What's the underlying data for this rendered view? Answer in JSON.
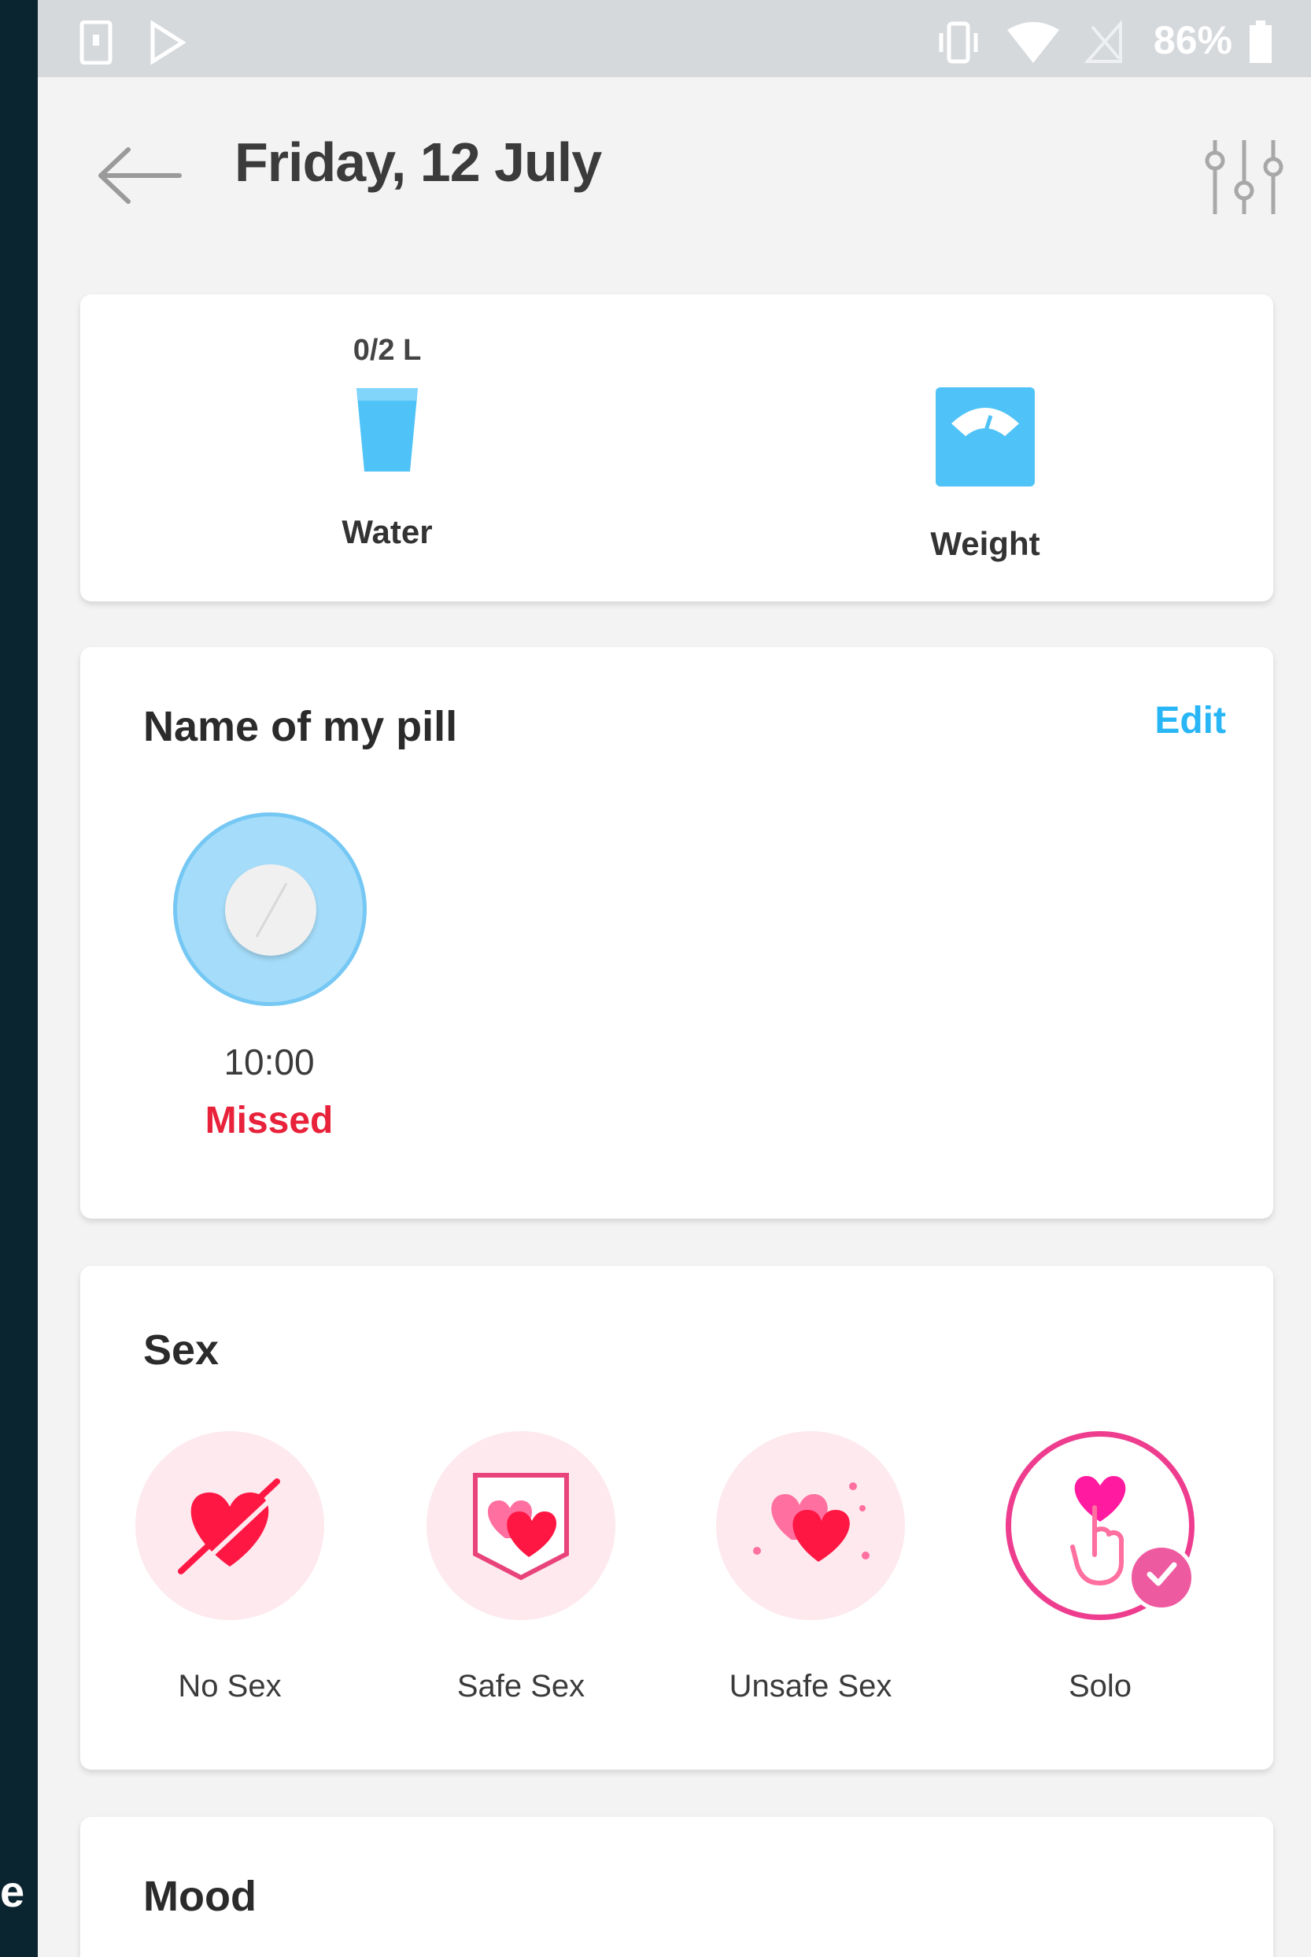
{
  "edge_fragment": "e",
  "status_bar": {
    "battery_percent": "86%"
  },
  "header": {
    "title": "Friday, 12 July"
  },
  "trackers": {
    "water": {
      "amount": "0/2 L",
      "label": "Water"
    },
    "weight": {
      "label": "Weight"
    }
  },
  "pill": {
    "title": "Name of my pill",
    "edit_label": "Edit",
    "time": "10:00",
    "status": "Missed"
  },
  "sex": {
    "title": "Sex",
    "options": [
      {
        "label": "No Sex",
        "selected": false
      },
      {
        "label": "Safe Sex",
        "selected": false
      },
      {
        "label": "Unsafe Sex",
        "selected": false
      },
      {
        "label": "Solo",
        "selected": true
      }
    ]
  },
  "mood": {
    "title": "Mood"
  },
  "colors": {
    "accent_blue": "#29b6f6",
    "missed_red": "#e8223a",
    "selected_pink": "#ee3d8f",
    "heart_red": "#ff1744"
  }
}
